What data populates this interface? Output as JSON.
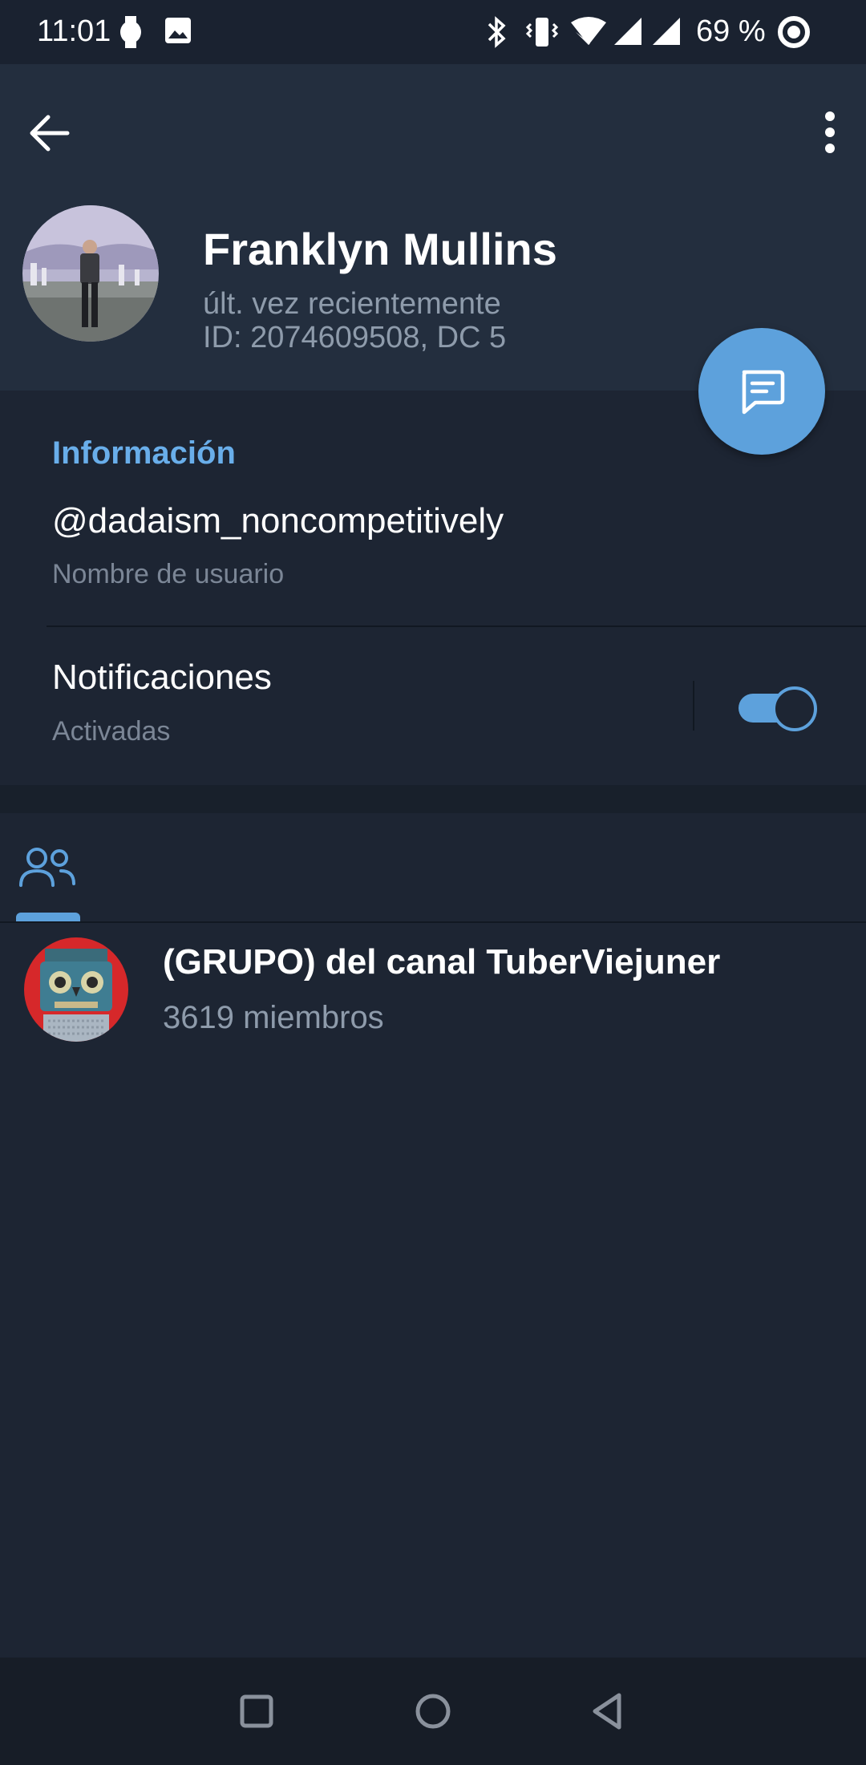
{
  "status_bar": {
    "time": "11:01",
    "battery": "69 %",
    "icons": [
      "watch-icon",
      "image-icon",
      "bluetooth-icon",
      "vibrate-icon",
      "wifi-icon",
      "signal-icon",
      "signal-icon",
      "battery-saver-icon"
    ]
  },
  "header": {
    "name": "Franklyn Mullins",
    "status": "últ. vez recientemente",
    "id_line": "ID: 2074609508, DC 5"
  },
  "info": {
    "section_title": "Información",
    "username": "@dadaism_noncompetitively",
    "username_label": "Nombre de usuario",
    "notifications_title": "Notificaciones",
    "notifications_state": "Activadas",
    "notifications_on": true
  },
  "tabs": [
    {
      "name": "groups-icon",
      "active": true
    }
  ],
  "groups": [
    {
      "name": "(GRUPO) del canal TuberViejuner",
      "members": "3619 miembros"
    }
  ],
  "colors": {
    "accent": "#5da1dc",
    "section_title": "#69aeea",
    "background": "#1d2533",
    "header_bg": "#232e3e"
  }
}
